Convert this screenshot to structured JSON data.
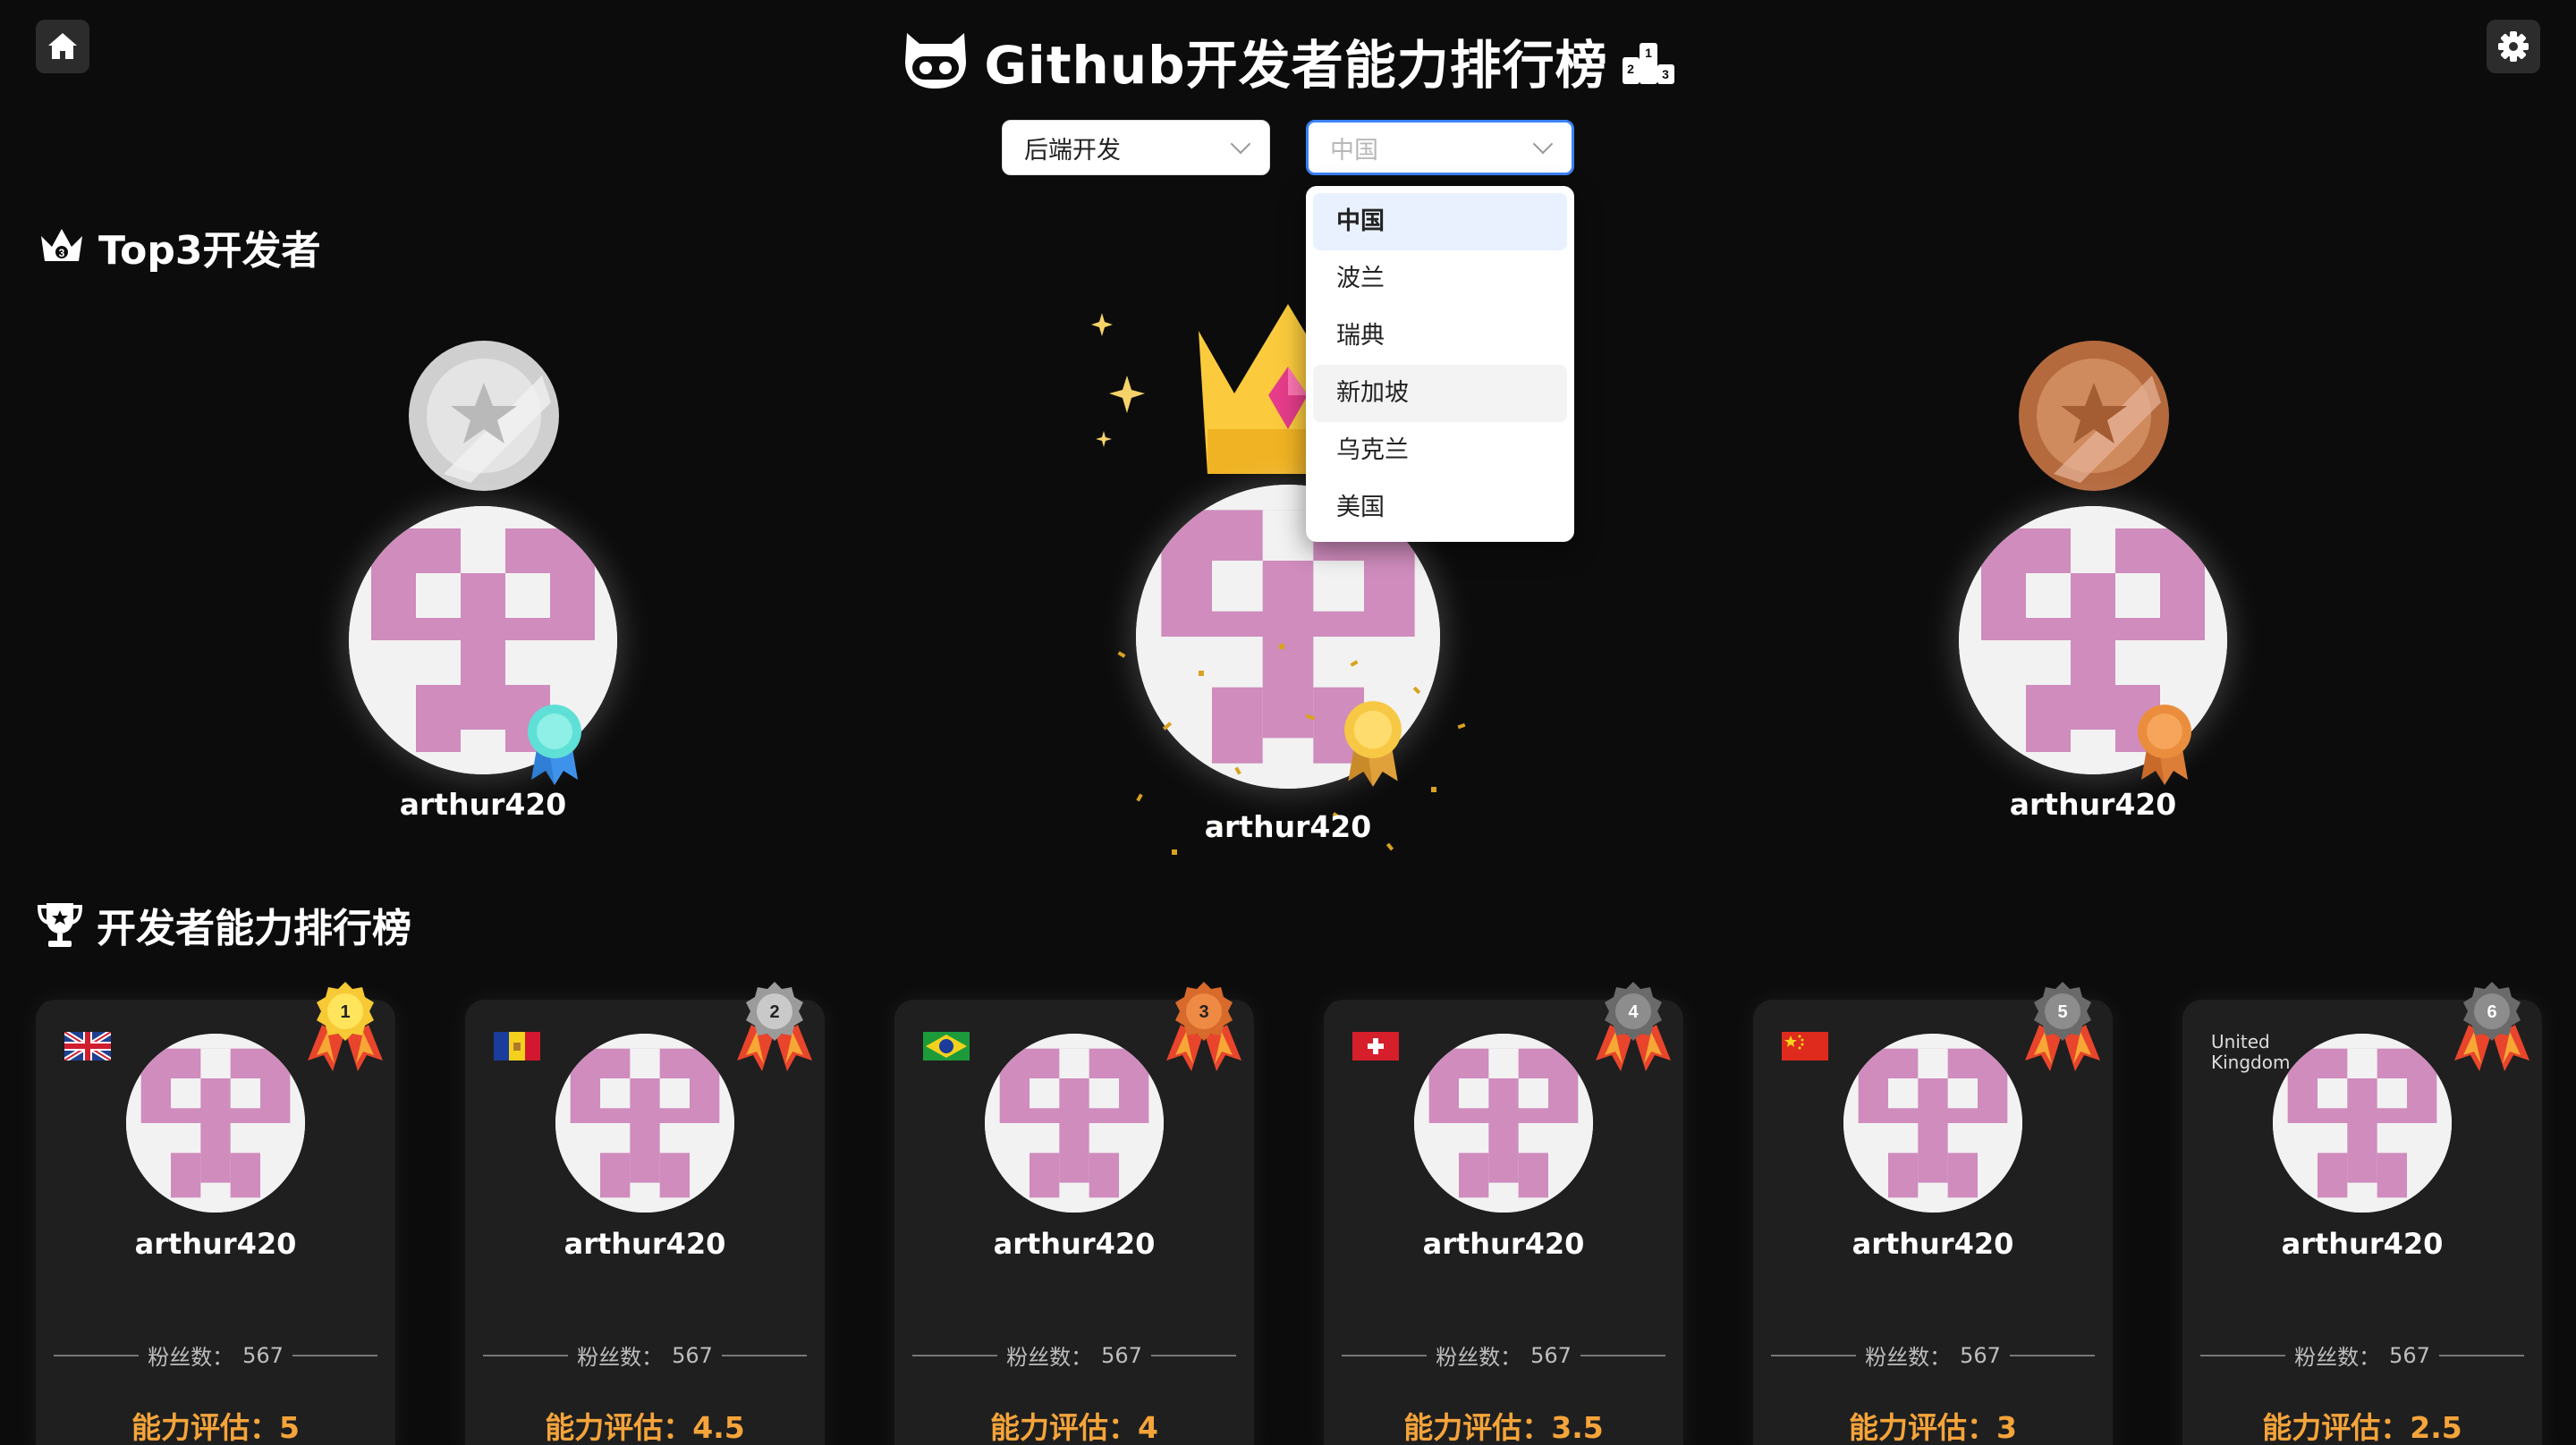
{
  "header": {
    "title": "Github开发者能力排行榜",
    "home_icon": "home-icon",
    "settings_icon": "gear-icon"
  },
  "filters": {
    "category": {
      "value": "后端开发"
    },
    "country": {
      "placeholder": "中国",
      "options": [
        "中国",
        "波兰",
        "瑞典",
        "新加坡",
        "乌克兰",
        "美国"
      ],
      "selected_index": 0,
      "hover_index": 3
    }
  },
  "top3": {
    "heading": "Top3开发者",
    "podium": [
      {
        "place": 2,
        "name": "arthur420",
        "medal": "silver"
      },
      {
        "place": 1,
        "name": "arthur420",
        "medal": "gold-crown"
      },
      {
        "place": 3,
        "name": "arthur420",
        "medal": "bronze"
      }
    ]
  },
  "ranking": {
    "heading": "开发者能力排行榜",
    "fans_label": "粉丝数：",
    "score_label": "能力评估：",
    "cards": [
      {
        "rank": "1",
        "name": "arthur420",
        "fans": "567",
        "score": "5",
        "flag": "uk-flag"
      },
      {
        "rank": "2",
        "name": "arthur420",
        "fans": "567",
        "score": "4.5",
        "flag": "andorra-flag"
      },
      {
        "rank": "3",
        "name": "arthur420",
        "fans": "567",
        "score": "4",
        "flag": "brazil-flag"
      },
      {
        "rank": "4",
        "name": "arthur420",
        "fans": "567",
        "score": "3.5",
        "flag": "switzerland-flag"
      },
      {
        "rank": "5",
        "name": "arthur420",
        "fans": "567",
        "score": "3",
        "flag": "china-flag"
      },
      {
        "rank": "6",
        "name": "arthur420",
        "fans": "567",
        "score": "2.5",
        "flag_alt": "United Kingdom"
      }
    ]
  },
  "colors": {
    "background": "#0c0c0c",
    "card": "#1f1f1f",
    "accent_score": "#f5a43a",
    "avatar_pink": "#cf8cbd",
    "select_focus": "#3b82f6"
  }
}
